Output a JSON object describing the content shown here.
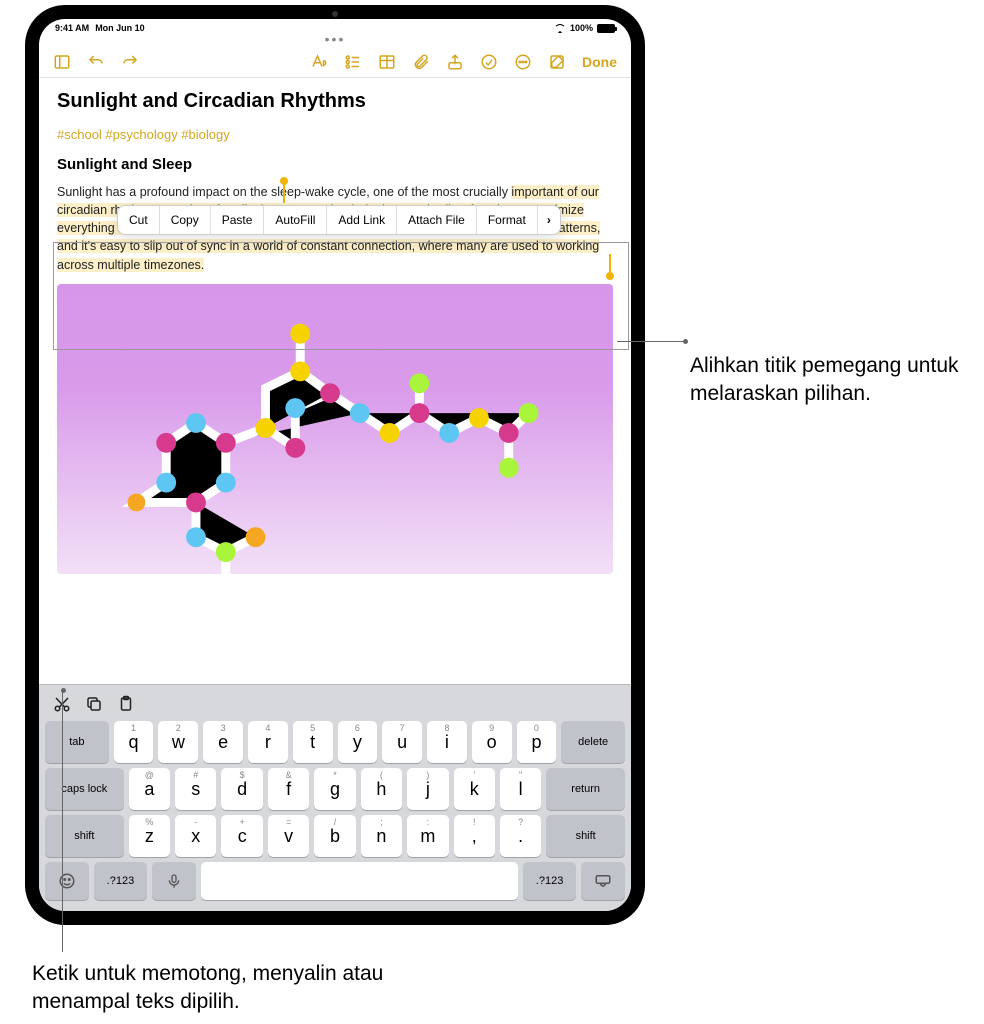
{
  "status": {
    "time": "9:41 AM",
    "date": "Mon Jun 10",
    "battery_pct": "100%"
  },
  "toolbar": {
    "done": "Done"
  },
  "note": {
    "title": "Sunlight and Circadian Rhythms",
    "tags": "#school #psychology #biology",
    "subtitle": "Sunlight and Sleep",
    "para_lead": "Sunlight has a profound impact on the sleep-wake cycle, one of the most crucially ",
    "para_selected": "important of our circadian rhythms–a series of cyclical processes that help time our bodies' functions to optimize everything from wakefulness to digestion. Consistency is key to developing healthy sleep patterns, and it's easy to slip out of sync in a world of constant connection, where many are used to working across multiple timezones."
  },
  "context_menu": {
    "items": [
      "Cut",
      "Copy",
      "Paste",
      "AutoFill",
      "Add Link",
      "Attach File",
      "Format"
    ],
    "more": "›"
  },
  "keyboard": {
    "row1_subs": [
      "1",
      "2",
      "3",
      "4",
      "5",
      "6",
      "7",
      "8",
      "9",
      "0"
    ],
    "row1": [
      "q",
      "w",
      "e",
      "r",
      "t",
      "y",
      "u",
      "i",
      "o",
      "p"
    ],
    "row2_subs": [
      "@",
      "#",
      "$",
      "&",
      "*",
      "(",
      ")",
      "'",
      "\""
    ],
    "row2": [
      "a",
      "s",
      "d",
      "f",
      "g",
      "h",
      "j",
      "k",
      "l"
    ],
    "row3_subs": [
      "%",
      "-",
      "+",
      "=",
      "/",
      ";",
      ":",
      "!",
      "?"
    ],
    "row3": [
      "z",
      "x",
      "c",
      "v",
      "b",
      "n",
      "m",
      ",",
      "."
    ],
    "tab": "tab",
    "delete": "delete",
    "caps": "caps lock",
    "return": "return",
    "shift": "shift",
    "numkey": ".?123"
  },
  "callouts": {
    "right": "Alihkan titik pemegang untuk melaraskan pilihan.",
    "bottom": "Ketik untuk memotong, menyalin atau menampal teks dipilih."
  }
}
